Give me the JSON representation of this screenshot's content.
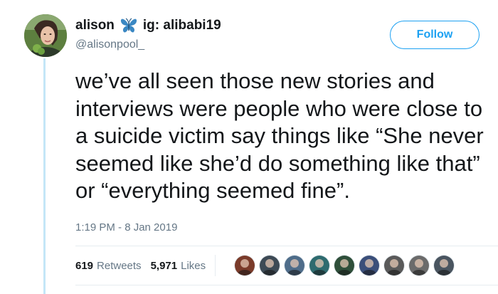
{
  "tweet": {
    "author": {
      "name": "alison",
      "bio_tag": "ig: alibabi19",
      "handle": "@alisonpool_",
      "badge_icon": "butterfly-icon"
    },
    "follow_label": "Follow",
    "text": "we’ve all seen those new stories and interviews were people who were close to a suicide victim say things like “She never seemed like she’d do something like that” or “everything seemed fine”.",
    "timestamp": "1:19 PM - 8 Jan 2019",
    "retweets": {
      "count": "619",
      "label": "Retweets"
    },
    "likes": {
      "count": "5,971",
      "label": "Likes"
    },
    "liker_avatar_colors": [
      "#7a3b2a",
      "#3d4a55",
      "#4f6d8a",
      "#2e6b6f",
      "#2f4f3a",
      "#3b4f7a",
      "#5a5a5a",
      "#6b6b6b",
      "#4a5560"
    ]
  },
  "colors": {
    "accent": "#1da1f2",
    "text": "#14171a",
    "muted": "#657786",
    "thread_line": "#c4e6f7"
  }
}
